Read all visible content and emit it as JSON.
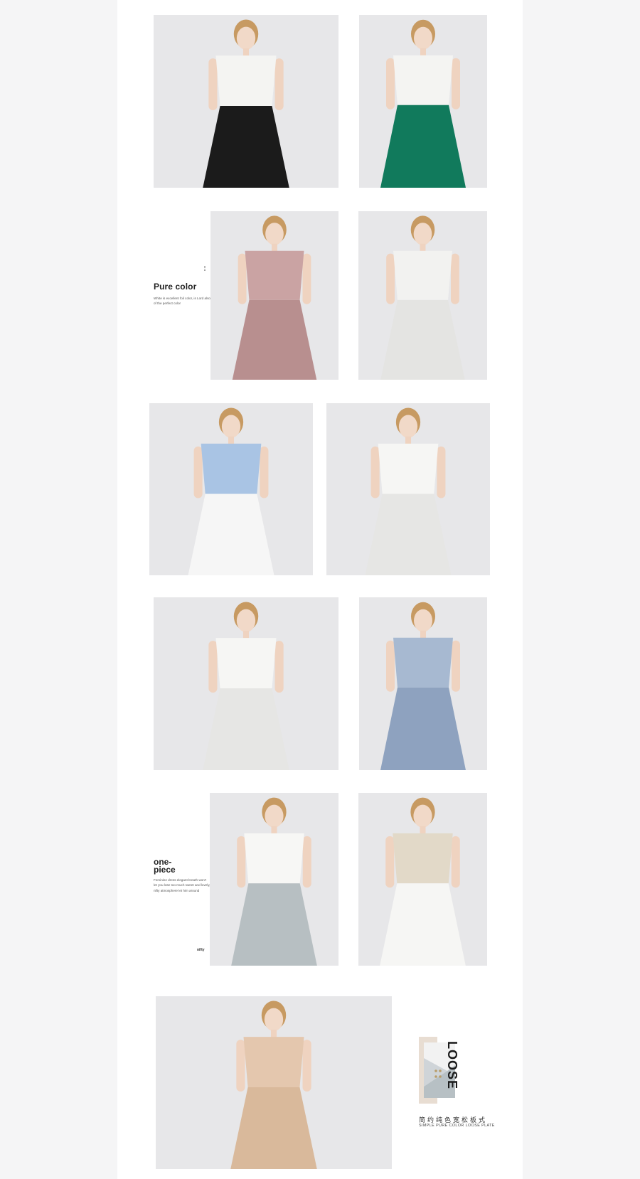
{
  "sections": {
    "pure_color": {
      "title": "Pure color",
      "text": "White is excellent foil color, is Lord also of the perfect color"
    },
    "one_piece": {
      "title_line1": "one-",
      "title_line2": "piece",
      "text": "Feminine dress elegant breath won't let you lose too much sweet and lovely, nifty atmosphere let him around",
      "mark": "nifty"
    },
    "loose": {
      "word": "LOOSE",
      "cn_caption": "简约纯色宽松板式",
      "en_caption": "SIMPLE PURE COLOR LOOSE PLATE"
    }
  },
  "photos": [
    {
      "name": "white-blouse-black-pants",
      "garment_color": "#f4f4f2",
      "accent_color": "#1b1b1b"
    },
    {
      "name": "off-shoulder-blouse-green-skirt",
      "garment_color": "#f4f4f2",
      "accent_color": "#117a5c"
    },
    {
      "name": "pink-lace-slip-dress",
      "garment_color": "#caa3a3",
      "accent_color": "#b88f8f"
    },
    {
      "name": "white-asymmetric-dress",
      "garment_color": "#f2f2f0",
      "accent_color": "#e4e4e2"
    },
    {
      "name": "blue-ruffle-dress",
      "garment_color": "#a9c4e4",
      "accent_color": "#f6f6f6"
    },
    {
      "name": "white-off-shoulder-dress",
      "garment_color": "#f6f6f4",
      "accent_color": "#e6e6e4"
    },
    {
      "name": "white-cross-front-dress",
      "garment_color": "#f6f6f4",
      "accent_color": "#e6e6e4"
    },
    {
      "name": "blue-wrap-dress",
      "garment_color": "#a7b9d1",
      "accent_color": "#8ea2bf"
    },
    {
      "name": "white-jacket-grey-skirt",
      "garment_color": "#f7f7f5",
      "accent_color": "#b7bfc2"
    },
    {
      "name": "beige-jacket-set",
      "garment_color": "#e2d9c8",
      "accent_color": "#f6f6f4"
    },
    {
      "name": "beige-belted-coat",
      "garment_color": "#e4c7ae",
      "accent_color": "#d9b99b"
    }
  ]
}
